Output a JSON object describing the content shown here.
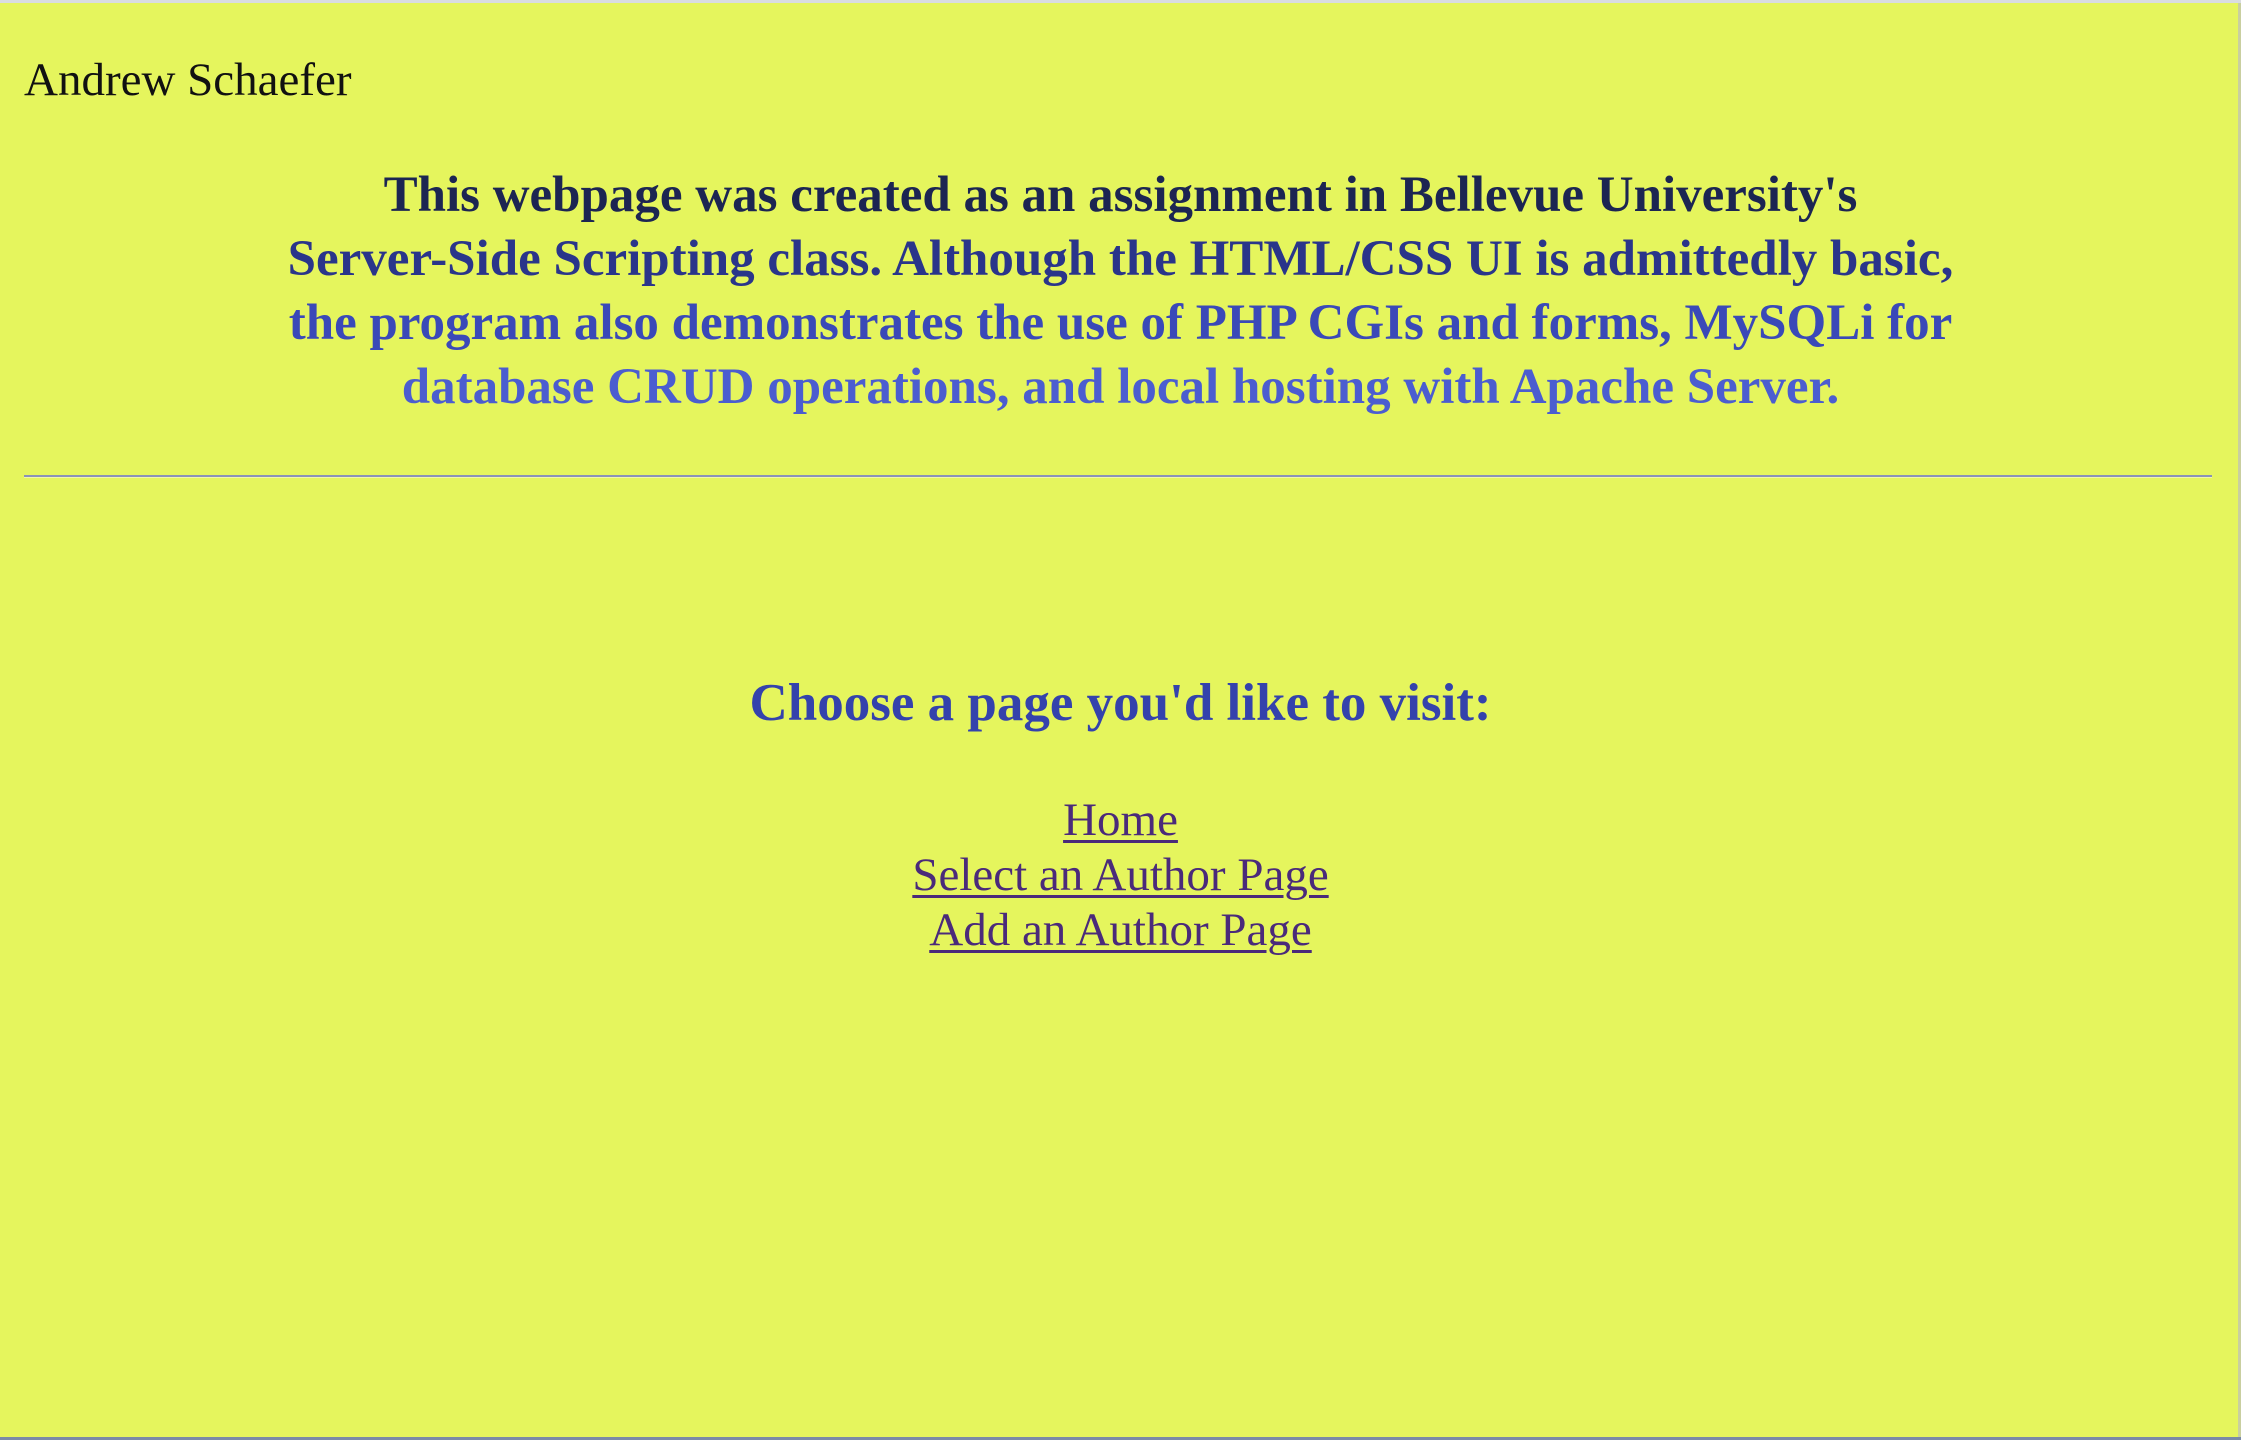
{
  "header": {
    "author_name": "Andrew Schaefer"
  },
  "intro": {
    "line1": "This webpage was created as an assignment in Bellevue University's",
    "line2": "Server-Side Scripting class. Although the HTML/CSS UI is admittedly basic,",
    "line3": "the program also demonstrates the use of PHP CGIs and forms, MySQLi for",
    "line4": "database CRUD operations, and local hosting with Apache Server."
  },
  "nav": {
    "prompt": "Choose a page you'd like to visit:",
    "links": [
      {
        "label": "Home"
      },
      {
        "label": "Select an Author Page"
      },
      {
        "label": "Add an Author Page"
      }
    ]
  },
  "colors": {
    "background": "#e5f55d",
    "link": "#4a2a7a",
    "heading": "#3442ac"
  }
}
